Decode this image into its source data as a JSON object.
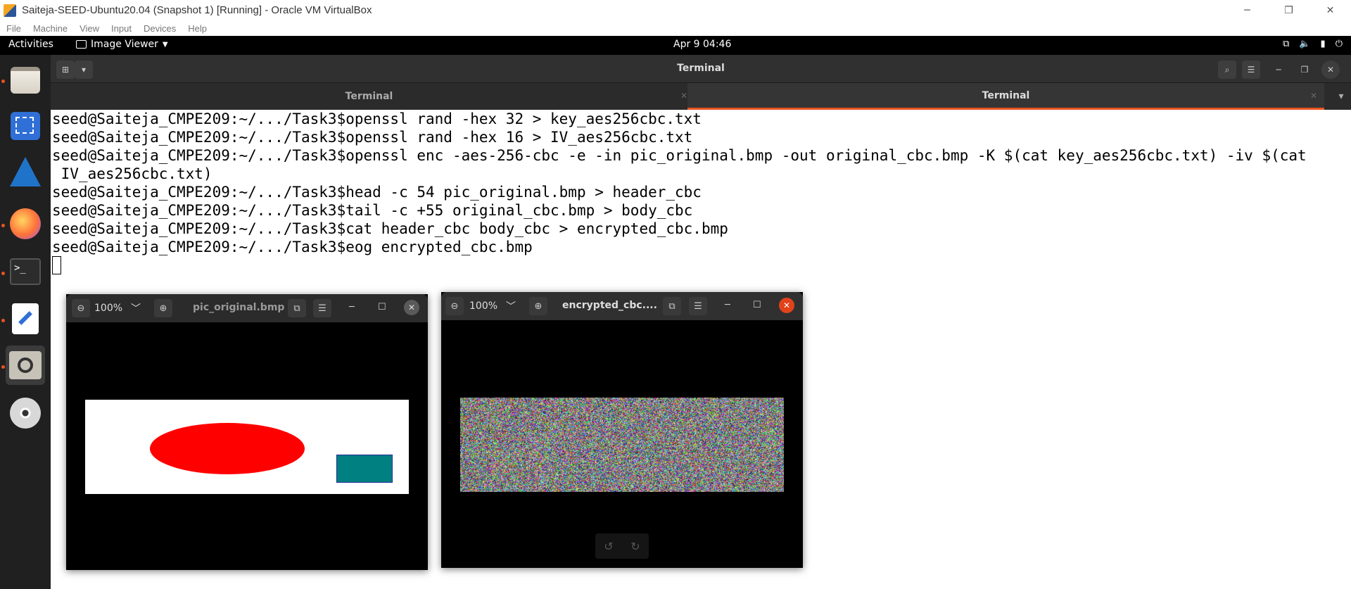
{
  "virtualbox": {
    "title": "Saiteja-SEED-Ubuntu20.04 (Snapshot 1) [Running] - Oracle VM VirtualBox",
    "menus": [
      "File",
      "Machine",
      "View",
      "Input",
      "Devices",
      "Help"
    ],
    "controls": {
      "minimize": "─",
      "restore": "❐",
      "close": "✕"
    }
  },
  "gnome": {
    "activities": "Activities",
    "app_menu": "Image Viewer",
    "clock": "Apr 9  04:46",
    "tray_icons": [
      "network-icon",
      "volume-icon",
      "battery-icon",
      "power-icon"
    ]
  },
  "dock": {
    "items": [
      "files-icon",
      "screenshot-icon",
      "wireshark-icon",
      "firefox-icon",
      "terminal-icon",
      "text-editor-icon",
      "image-viewer-icon",
      "disc-icon"
    ],
    "terminal_glyph": ">_"
  },
  "terminal": {
    "title": "Terminal",
    "tabs": [
      {
        "label": "Terminal",
        "active": false
      },
      {
        "label": "Terminal",
        "active": true
      }
    ],
    "lines": [
      "seed@Saiteja_CMPE209:~/.../Task3$openssl rand -hex 32 > key_aes256cbc.txt",
      "seed@Saiteja_CMPE209:~/.../Task3$openssl rand -hex 16 > IV_aes256cbc.txt",
      "seed@Saiteja_CMPE209:~/.../Task3$openssl enc -aes-256-cbc -e -in pic_original.bmp -out original_cbc.bmp -K $(cat key_aes256cbc.txt) -iv $(cat",
      " IV_aes256cbc.txt)",
      "seed@Saiteja_CMPE209:~/.../Task3$head -c 54 pic_original.bmp > header_cbc",
      "seed@Saiteja_CMPE209:~/.../Task3$tail -c +55 original_cbc.bmp > body_cbc",
      "seed@Saiteja_CMPE209:~/.../Task3$cat header_cbc body_cbc > encrypted_cbc.bmp",
      "seed@Saiteja_CMPE209:~/.../Task3$eog encrypted_cbc.bmp"
    ]
  },
  "viewer_original": {
    "zoom": "100%",
    "title": "pic_original.bmp",
    "shape_colors": {
      "background": "#ffffff",
      "ellipse": "#ff0000",
      "rectangle": "#008080"
    }
  },
  "viewer_encrypted": {
    "zoom": "100%",
    "title": "encrypted_cbc...."
  }
}
